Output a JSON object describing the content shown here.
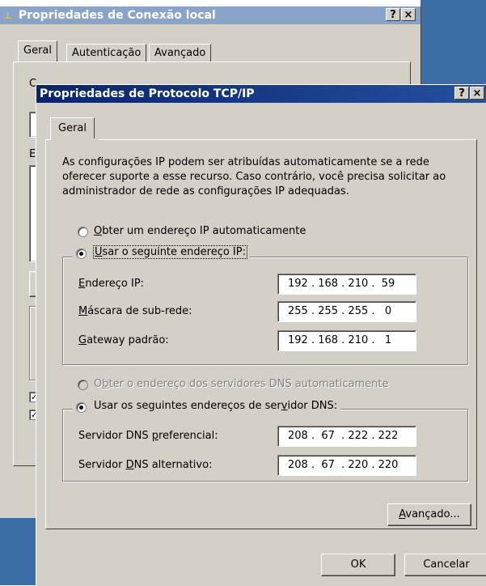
{
  "background_window": {
    "title": "Propriedades de Conexão local",
    "tabs": [
      "Geral",
      "Autenticação",
      "Avançado"
    ],
    "help_btn": "?",
    "close_btn": "×",
    "partial_letters": [
      "C",
      "E"
    ]
  },
  "dialog": {
    "title": "Propriedades de Protocolo TCP/IP",
    "help_btn": "?",
    "close_btn": "×",
    "tab_label": "Geral",
    "description": "As configurações IP podem ser atribuídas automaticamente se a rede oferecer suporte a esse recurso. Caso contrário, você precisa solicitar ao administrador de rede as configurações IP adequadas.",
    "ip_auto": {
      "pre": "",
      "key": "O",
      "post": "bter um endereço IP automaticamente"
    },
    "ip_manual": {
      "pre": "",
      "key": "U",
      "post": "sar o seguinte endereço IP:"
    },
    "ip_fields": [
      {
        "pre": "",
        "key": "E",
        "post": "ndereço IP:",
        "value": "192 . 168 . 210 .  59"
      },
      {
        "pre": "",
        "key": "M",
        "post": "áscara de sub-rede:",
        "value": "255 . 255 . 255 .   0"
      },
      {
        "pre": "",
        "key": "G",
        "post": "ateway padrão:",
        "value": "192 . 168 . 210 .   1"
      }
    ],
    "dns_auto": {
      "pre": "O",
      "key": "b",
      "post": "ter o endereço dos servidores DNS automaticamente"
    },
    "dns_manual": {
      "pre": "Usar os seguintes endereços de ser",
      "key": "v",
      "post": "idor DNS:"
    },
    "dns_fields": [
      {
        "pre": "Servidor DNS ",
        "key": "p",
        "post": "referencial:",
        "value": "208 .  67  . 222 . 222"
      },
      {
        "pre": "Servidor ",
        "key": "D",
        "post": "NS alternativo:",
        "value": "208 .  67  . 220 . 220"
      }
    ],
    "advanced": {
      "pre": "",
      "key": "A",
      "post": "vançado..."
    },
    "ok": "OK",
    "cancel": "Cancelar"
  },
  "colors": {
    "desktop": "#3a6ea5",
    "inactive_title": "#7a96c0",
    "active_title": "#0a246a",
    "face": "#d4d0c8"
  }
}
